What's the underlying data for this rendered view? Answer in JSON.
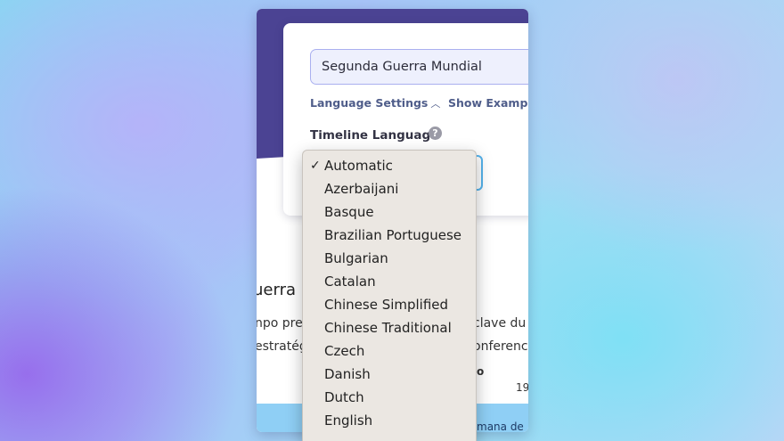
{
  "search": {
    "value": "Segunda Guerra Mundial"
  },
  "links": {
    "language_settings": "Language Settings",
    "show_examples": "Show Example"
  },
  "timeline_language": {
    "label": "Timeline Language",
    "help": "?"
  },
  "dropdown": {
    "selected": "Automatic",
    "check": "✓",
    "options": [
      "Automatic",
      "Azerbaijani",
      "Basque",
      "Brazilian Portuguese",
      "Bulgarian",
      "Catalan",
      "Chinese Simplified",
      "Chinese Traditional",
      "Czech",
      "Danish",
      "Dutch",
      "English"
    ]
  },
  "background_content": {
    "title_fragment": "uerra I",
    "line1_left": "npo pre",
    "line1_right": "clave du",
    "line2_left": "estratég",
    "line2_right": "onferenci",
    "frag_o": "o",
    "frag_19": "19",
    "bottom_text": "mana de"
  },
  "colors": {
    "hero": "#4b4393",
    "accent_border": "#55b3ec",
    "link": "#4f5d8a",
    "dropdown_bg": "#ebe7e2"
  }
}
